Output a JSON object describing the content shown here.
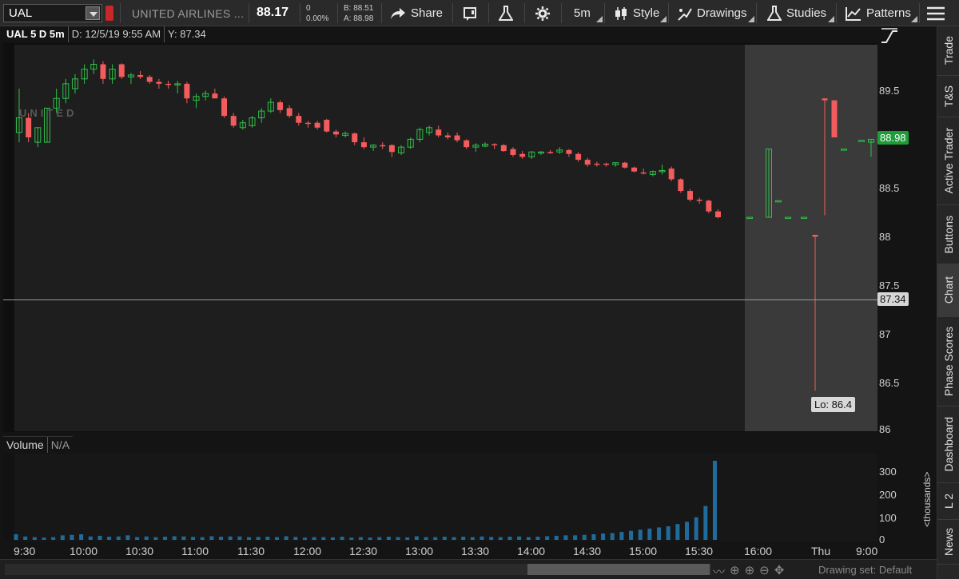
{
  "toolbar": {
    "symbol": "UAL",
    "company": "UNITED AIRLINES ...",
    "last": "88.17",
    "change": "0",
    "change_pct": "0.00%",
    "bid": "B: 88.51",
    "ask": "A: 88.98",
    "share": "Share",
    "interval": "5m",
    "style": "Style",
    "drawings": "Drawings",
    "studies": "Studies",
    "patterns": "Patterns"
  },
  "chart_header": {
    "label": "UAL 5 D 5m",
    "date": "D: 12/5/19 9:55 AM",
    "y": "Y: 87.34"
  },
  "watermark": "UNITED",
  "price_axis": {
    "ticks": [
      "89.5",
      "89",
      "88.5",
      "88",
      "87.5",
      "87",
      "86.5",
      "86"
    ],
    "last_badge": "88.98",
    "cross_badge": "87.34",
    "low_label": "Lo: 86.4"
  },
  "volume": {
    "label": "Volume",
    "value": "N/A",
    "ticks": [
      "300",
      "200",
      "100",
      "0"
    ],
    "unit": "<thousands>"
  },
  "time_axis": [
    "9:30",
    "10:00",
    "10:30",
    "11:00",
    "11:30",
    "12:00",
    "12:30",
    "13:00",
    "13:30",
    "14:00",
    "14:30",
    "15:00",
    "15:30",
    "16:00",
    "Thu",
    "9:00"
  ],
  "bottom": {
    "drawing_set": "Drawing set: Default"
  },
  "sidebar": [
    "Trade",
    "T&S",
    "Active Trader",
    "Buttons",
    "Chart",
    "Phase Scores",
    "Dashboard",
    "L 2",
    "News"
  ],
  "colors": {
    "up": "#2fbf4a",
    "down": "#f25c5c",
    "volume": "#1f6c9c"
  },
  "chart_data": {
    "type": "candlestick",
    "y_range": [
      86,
      89.8
    ],
    "candles": [
      [
        89.05,
        89.5,
        88.95,
        89.2
      ],
      [
        89.2,
        89.25,
        88.95,
        89.0
      ],
      [
        88.95,
        89.1,
        88.9,
        89.1
      ],
      [
        88.95,
        89.3,
        88.95,
        89.3
      ],
      [
        89.3,
        89.5,
        89.25,
        89.4
      ],
      [
        89.4,
        89.6,
        89.35,
        89.55
      ],
      [
        89.5,
        89.65,
        89.45,
        89.6
      ],
      [
        89.6,
        89.75,
        89.55,
        89.7
      ],
      [
        89.7,
        89.8,
        89.65,
        89.75
      ],
      [
        89.75,
        89.78,
        89.55,
        89.6
      ],
      [
        89.6,
        89.75,
        89.55,
        89.7
      ],
      [
        89.75,
        89.76,
        89.6,
        89.62
      ],
      [
        89.62,
        89.66,
        89.55,
        89.64
      ],
      [
        89.64,
        89.68,
        89.6,
        89.62
      ],
      [
        89.62,
        89.64,
        89.55,
        89.57
      ],
      [
        89.57,
        89.6,
        89.5,
        89.55
      ],
      [
        89.55,
        89.58,
        89.5,
        89.54
      ],
      [
        89.54,
        89.58,
        89.45,
        89.55
      ],
      [
        89.55,
        89.57,
        89.35,
        89.4
      ],
      [
        89.38,
        89.45,
        89.3,
        89.42
      ],
      [
        89.42,
        89.48,
        89.38,
        89.45
      ],
      [
        89.45,
        89.5,
        89.4,
        89.4
      ],
      [
        89.4,
        89.42,
        89.2,
        89.22
      ],
      [
        89.22,
        89.25,
        89.1,
        89.12
      ],
      [
        89.1,
        89.18,
        89.08,
        89.15
      ],
      [
        89.12,
        89.22,
        89.1,
        89.2
      ],
      [
        89.2,
        89.3,
        89.15,
        89.27
      ],
      [
        89.27,
        89.4,
        89.25,
        89.36
      ],
      [
        89.36,
        89.38,
        89.25,
        89.28
      ],
      [
        89.3,
        89.33,
        89.2,
        89.22
      ],
      [
        89.22,
        89.25,
        89.12,
        89.15
      ],
      [
        89.15,
        89.17,
        89.1,
        89.14
      ],
      [
        89.15,
        89.17,
        89.08,
        89.1
      ],
      [
        89.18,
        89.19,
        89.05,
        89.06
      ],
      [
        89.06,
        89.08,
        89.0,
        89.03
      ],
      [
        89.02,
        89.06,
        89.0,
        89.04
      ],
      [
        89.04,
        89.05,
        88.92,
        88.95
      ],
      [
        88.95,
        89.0,
        88.88,
        88.9
      ],
      [
        88.9,
        88.93,
        88.86,
        88.92
      ],
      [
        88.92,
        88.95,
        88.88,
        88.91
      ],
      [
        88.92,
        88.93,
        88.8,
        88.85
      ],
      [
        88.84,
        88.92,
        88.82,
        88.9
      ],
      [
        88.9,
        89.0,
        88.88,
        88.98
      ],
      [
        88.98,
        89.1,
        88.95,
        89.08
      ],
      [
        89.05,
        89.12,
        89.02,
        89.1
      ],
      [
        89.08,
        89.12,
        89.0,
        89.02
      ],
      [
        89.02,
        89.05,
        88.98,
        89.0
      ],
      [
        89.02,
        89.05,
        88.95,
        88.97
      ],
      [
        88.97,
        88.98,
        88.88,
        88.9
      ],
      [
        88.9,
        88.94,
        88.85,
        88.92
      ],
      [
        88.91,
        88.95,
        88.9,
        88.93
      ],
      [
        88.93,
        88.94,
        88.88,
        88.92
      ],
      [
        88.92,
        88.93,
        88.85,
        88.86
      ],
      [
        88.88,
        88.9,
        88.8,
        88.82
      ],
      [
        88.83,
        88.86,
        88.78,
        88.8
      ],
      [
        88.8,
        88.86,
        88.78,
        88.85
      ],
      [
        88.84,
        88.86,
        88.82,
        88.85
      ],
      [
        88.85,
        88.87,
        88.83,
        88.84
      ],
      [
        88.85,
        88.9,
        88.83,
        88.87
      ],
      [
        88.87,
        88.88,
        88.8,
        88.83
      ],
      [
        88.83,
        88.85,
        88.75,
        88.77
      ],
      [
        88.77,
        88.79,
        88.7,
        88.72
      ],
      [
        88.73,
        88.75,
        88.7,
        88.72
      ],
      [
        88.73,
        88.74,
        88.7,
        88.72
      ],
      [
        88.72,
        88.74,
        88.7,
        88.74
      ],
      [
        88.74,
        88.75,
        88.68,
        88.69
      ],
      [
        88.69,
        88.7,
        88.64,
        88.65
      ],
      [
        88.64,
        88.68,
        88.62,
        88.63
      ],
      [
        88.62,
        88.66,
        88.6,
        88.65
      ],
      [
        88.66,
        88.72,
        88.62,
        88.66
      ],
      [
        88.68,
        88.7,
        88.55,
        88.57
      ],
      [
        88.57,
        88.58,
        88.43,
        88.45
      ],
      [
        88.45,
        88.47,
        88.34,
        88.36
      ],
      [
        88.36,
        88.38,
        88.32,
        88.35
      ],
      [
        88.35,
        88.36,
        88.22,
        88.24
      ],
      [
        88.24,
        88.26,
        88.17,
        88.18
      ]
    ],
    "extended": [
      [
        88.18,
        88.18,
        88.18,
        88.18
      ],
      [
        88.18,
        88.88,
        88.18,
        88.88
      ],
      [
        88.35,
        88.35,
        88.35,
        88.35
      ],
      [
        88.18,
        88.18,
        88.18,
        88.18
      ],
      [
        88.18,
        88.18,
        88.18,
        88.18
      ],
      [
        88.0,
        88.0,
        86.4,
        87.98
      ],
      [
        89.4,
        89.4,
        88.2,
        89.38
      ],
      [
        89.38,
        89.38,
        89.0,
        89.0
      ],
      [
        88.88,
        88.88,
        88.88,
        88.88
      ],
      [
        88.97,
        88.97,
        88.97,
        88.97
      ],
      [
        88.95,
        88.98,
        88.8,
        88.98
      ]
    ],
    "volume_thousands": [
      25,
      15,
      12,
      10,
      12,
      20,
      22,
      25,
      15,
      18,
      14,
      15,
      20,
      12,
      15,
      12,
      14,
      16,
      15,
      13,
      12,
      16,
      14,
      15,
      15,
      12,
      13,
      14,
      12,
      16,
      13,
      10,
      12,
      12,
      11,
      14,
      10,
      12,
      10,
      12,
      14,
      12,
      11,
      16,
      12,
      12,
      14,
      12,
      14,
      12,
      15,
      13,
      12,
      14,
      15,
      12,
      14,
      16,
      18,
      20,
      20,
      22,
      25,
      28,
      30,
      35,
      40,
      45,
      50,
      55,
      60,
      70,
      80,
      100,
      150,
      350
    ]
  }
}
